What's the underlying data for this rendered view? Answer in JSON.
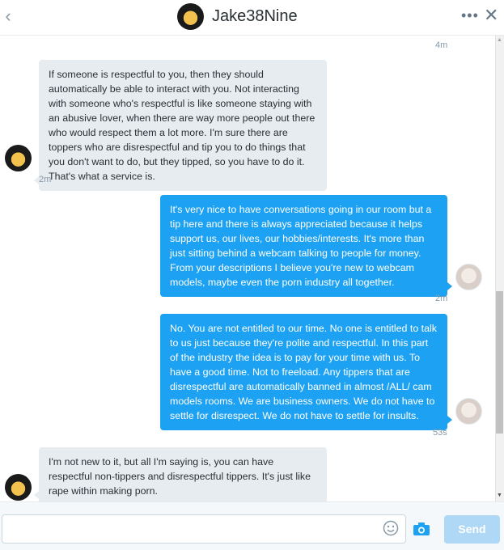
{
  "header": {
    "back_icon": "chevron-left-icon",
    "title": "Jake38Nine",
    "more_icon": "more-dots-icon",
    "close_icon": "close-icon"
  },
  "messages": [
    {
      "from": "other",
      "text": "If someone is respectful to you, then they should automatically be able to interact with you. Not interacting with someone who's respectful is like someone staying with an abusive lover, when there are way more people out there who would respect them a lot more. I'm sure there are toppers who are disrespectful and tip you to do things that you don't want to do, but they tipped, so you have to do it. That's what a service is."
    },
    {
      "from": "me",
      "text": "It's very nice to have conversations going in our room but a tip here and there is always appreciated because it helps support us, our lives, our hobbies/interests. It's more than just sitting behind a webcam talking to people for money. From your descriptions I believe you're new to webcam models, maybe even the porn industry all together."
    },
    {
      "from": "me",
      "text": "No. You are not entitled to our time. No one is entitled to talk to us just because they're polite and respectful. In this part of the industry the idea is to pay for your time with us. To have a good time. Not to freeload. Any tippers that are disrespectful are automatically banned in almost /ALL/ cam models rooms. We are business owners. We do not have to settle for disrespect. We do not have to settle for insults."
    },
    {
      "from": "other",
      "text": "I'm not new to it, but all I'm saying is, you can have respectful non-tippers and disrespectful tippers. It's just like rape within making porn."
    }
  ],
  "timestamps": {
    "top": "4m",
    "after_msg1": "2m",
    "after_msg2": "2m",
    "after_msg3": "53s"
  },
  "composer": {
    "input_value": "",
    "emoji_icon": "emoji-icon",
    "camera_icon": "camera-icon",
    "send_label": "Send"
  },
  "colors": {
    "outgoing_bubble": "#1da1f2",
    "incoming_bubble": "#e6ecf0",
    "send_disabled": "#aed8f5",
    "camera_icon": "#1da1f2"
  }
}
